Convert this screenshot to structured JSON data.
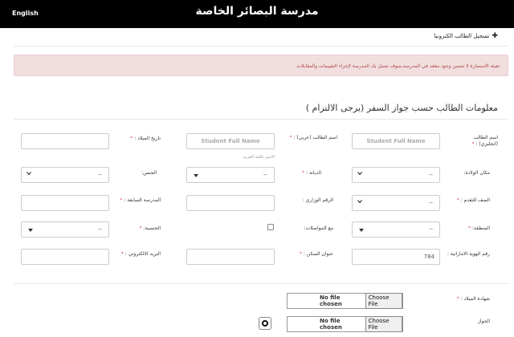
{
  "header": {
    "title": "مدرسة البصائر الخاصة",
    "language_link": "English"
  },
  "register_link": "تسجيل الطالب الكترونيا",
  "notice": "تعبئة الاستمارة لا تضمن وجود مقعد في المدرسة,سوف تتصل بك المدرسة لإجراء التقييمات والمقابلات.",
  "section_title": "معلومات الطالب حسب جواز السفر (يرجى الالتزام )",
  "colors": {
    "header_bg": "#000000",
    "alert_bg": "#f2dede",
    "alert_text": "#a94442",
    "required": "#d9534f"
  },
  "fields": {
    "name_en": {
      "label": "اسم الطالب (انجليزي) :",
      "placeholder": "Student Full Name",
      "required": true
    },
    "name_ar": {
      "label": "اسم الطالب (عربي) :",
      "placeholder": "Student Full Name",
      "hint": "الاسم باللغة العربية",
      "required": true
    },
    "birth_date": {
      "label": "تاريخ الميلاد :",
      "value": "",
      "required": true
    },
    "birth_place": {
      "label": "مكان الولادة:",
      "value": "--"
    },
    "religion": {
      "label": "الديانة :",
      "value": "--",
      "required": true
    },
    "gender": {
      "label": "الجنس:",
      "value": "--"
    },
    "grade": {
      "label": "الصف للتقدم :",
      "value": "--",
      "required": true
    },
    "ministry_number": {
      "label": "الرقم الوزاري :",
      "value": ""
    },
    "previous_school": {
      "label": "المدرسة السابقة :",
      "value": "",
      "required": true
    },
    "area": {
      "label": "المنطقة:",
      "value": "--",
      "required": true
    },
    "transport": {
      "label": "مع المواصلات:"
    },
    "nationality": {
      "label": "الجنسية:",
      "value": "--",
      "required": true
    },
    "emirates_id": {
      "label": "رقم الهوية الاماراتية :",
      "value": "784"
    },
    "address": {
      "label": "عنوان السكن :",
      "value": "",
      "required": true
    },
    "email": {
      "label": "البريد الالكتروني :",
      "value": "",
      "required": true
    },
    "certificate": {
      "label": "شهادة الميلاد :",
      "required": true,
      "file_status": "No file chosen",
      "button": "Choose File"
    },
    "passport": {
      "label": "الجواز",
      "file_status": "No file chosen",
      "button": "Choose File"
    }
  }
}
